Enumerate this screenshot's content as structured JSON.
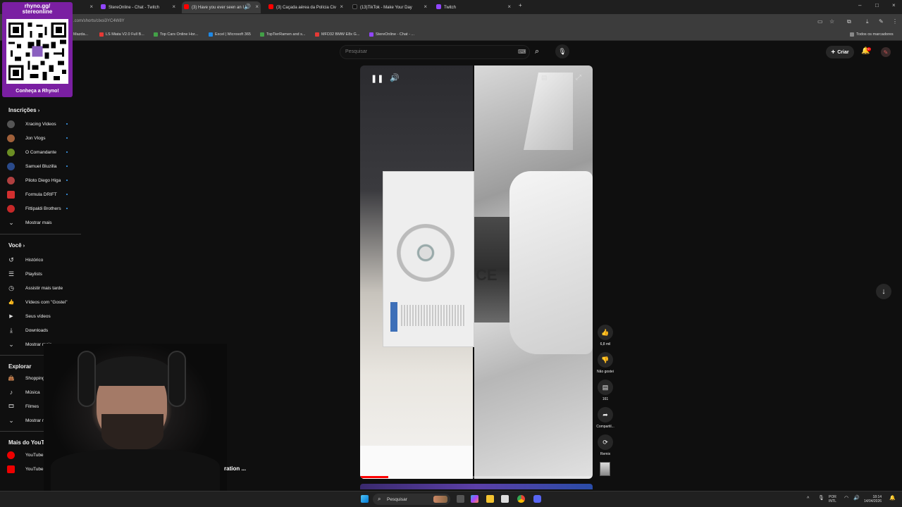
{
  "browser": {
    "tabs": [
      {
        "label": "",
        "active": false,
        "favicon_color": "#7a1fa2"
      },
      {
        "label": "StereOnline - Chat - Twitch",
        "active": false,
        "favicon_color": "#9146ff"
      },
      {
        "label": "(3) Have you ever seen an I",
        "active": true,
        "favicon_color": "#ff0000"
      },
      {
        "label": "(3) Caçada aérea da Polícia Civ",
        "active": false,
        "favicon_color": "#ff0000"
      },
      {
        "label": "(13)TikTok - Make Your Day",
        "active": false,
        "favicon_color": "#111111"
      },
      {
        "label": "Twitch",
        "active": false,
        "favicon_color": "#9146ff"
      }
    ],
    "new_tab": "+",
    "url": ".com/shorts/clxoi3YC4W8Y",
    "bookmarks": [
      {
        "label": "Mazda...",
        "color": "#888888"
      },
      {
        "label": "LS Miata V2.0 Full B...",
        "color": "#e53935"
      },
      {
        "label": "Top Cars Online Hor...",
        "color": "#43a047"
      },
      {
        "label": "Excel | Microsoft 365",
        "color": "#1e88e5"
      },
      {
        "label": "TopTierRamen and s...",
        "color": "#43a047"
      },
      {
        "label": "MFD32 BMW E8x G...",
        "color": "#e53935"
      },
      {
        "label": "StereOnline - Chat - ...",
        "color": "#9146ff"
      }
    ],
    "all_bookmarks": "Todos os marcadores"
  },
  "qr": {
    "title_line1": "rhyno.gg/",
    "title_line2": "stereonline",
    "cta": "Conheça a Rhyno!"
  },
  "sidebar": {
    "subscriptions_title": "Inscrições",
    "subscriptions": [
      {
        "label": "Xracing Videos",
        "color": "#555555"
      },
      {
        "label": "Jon Vlogs",
        "color": "#a0603a"
      },
      {
        "label": "O Comandante",
        "color": "#6b8e23"
      },
      {
        "label": "Samuel Bluzilla",
        "color": "#2a4a8a"
      },
      {
        "label": "Piloto Diego Higa",
        "color": "#b04040"
      },
      {
        "label": "Formula DRIFT",
        "color": "#d32f2f"
      },
      {
        "label": "Fittipaldi Brothers",
        "color": "#c62828"
      }
    ],
    "show_more": "Mostrar mais",
    "you_title": "Você",
    "you_items": [
      {
        "label": "Histórico",
        "icon": "history-icon",
        "glyph": "↺"
      },
      {
        "label": "Playlists",
        "icon": "playlists-icon",
        "glyph": "☰"
      },
      {
        "label": "Assistir mais tarde",
        "icon": "clock-icon",
        "glyph": "◷"
      },
      {
        "label": "Vídeos com \"Gostei\"",
        "icon": "thumbs-up-icon",
        "glyph": "👍"
      },
      {
        "label": "Seus vídeos",
        "icon": "video-icon",
        "glyph": "▶"
      },
      {
        "label": "Downloads",
        "icon": "download-icon",
        "glyph": "⤓"
      }
    ],
    "explore_title": "Explorar",
    "explore_items": [
      {
        "label": "Shopping",
        "icon": "shopping-bag-icon",
        "glyph": "👜"
      },
      {
        "label": "Música",
        "icon": "music-icon",
        "glyph": "♪"
      },
      {
        "label": "Filmes",
        "icon": "film-icon",
        "glyph": "🎞"
      }
    ],
    "more_title": "Mais do YouTube",
    "more_items": [
      {
        "label": "YouTube Music"
      },
      {
        "label": "YouTube Kids"
      }
    ]
  },
  "header": {
    "search_placeholder": "Pesquisar",
    "create_label": "Criar",
    "notifications_count": "9+"
  },
  "actions": {
    "like_count": "6,8 mil",
    "dislike_label": "Não gostei",
    "comments_count": "161",
    "share_label": "Compartil...",
    "remix_label": "Remix"
  },
  "video": {
    "progress": 0.12,
    "case_text": "CE"
  },
  "overlay": {
    "caption": "ration ..."
  },
  "taskbar": {
    "search_label": "Pesquisar",
    "lang_line1": "POR",
    "lang_line2": "INTL",
    "time": "18:14",
    "date": "14/04/2026"
  }
}
